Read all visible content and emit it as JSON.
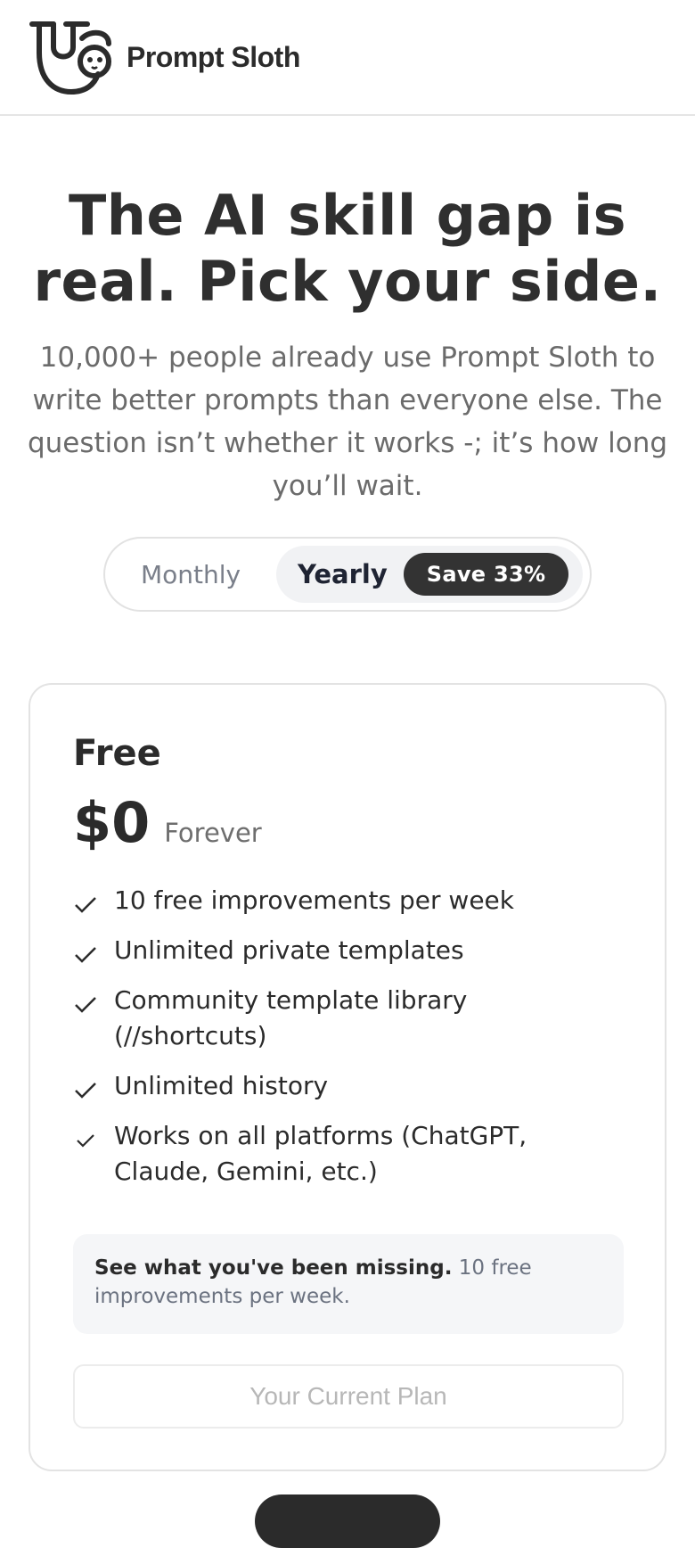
{
  "header": {
    "brand_name": "Prompt Sloth",
    "logo_icon": "sloth-logo-icon"
  },
  "hero": {
    "title": "The AI skill gap is real. Pick your side.",
    "subtitle": "10,000+ people already use Prompt Sloth to write better prompts than everyone else. The question isn’t whether it works -; it’s how long you’ll wait."
  },
  "billing_toggle": {
    "monthly_label": "Monthly",
    "yearly_label": "Yearly",
    "save_badge": "Save 33%",
    "selected": "Yearly"
  },
  "plan_card": {
    "name": "Free",
    "price": "$0",
    "period": "Forever",
    "features": [
      "10 free improvements per week",
      "Unlimited private templates",
      "Community template library (//shortcuts)",
      "Unlimited history",
      "Works on all platforms (ChatGPT, Claude, Gemini, etc.)"
    ],
    "note_strong": "See what you've been missing.",
    "note_rest": " 10 free improvements per week.",
    "cta_label": "Your Current Plan"
  },
  "colors": {
    "text_primary": "#2b2b2b",
    "text_muted": "#6b6b6b",
    "badge_bg": "#333333",
    "border": "#e3e3e3"
  }
}
